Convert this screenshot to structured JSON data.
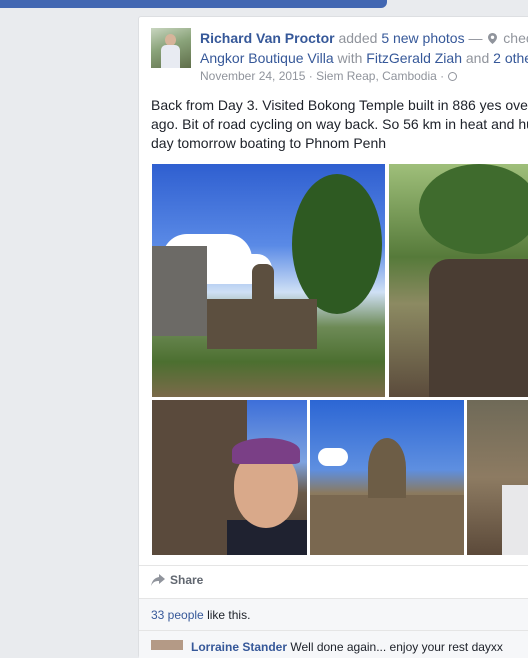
{
  "post": {
    "author": "Richard Van Proctor",
    "action": "added",
    "photo_count_label": "5 new photos",
    "dash": "—",
    "checkin_prefix": "chec",
    "place": "Angkor Boutique Villa",
    "with_word": "with",
    "tagged_person": "FitzGerald Ziah",
    "and_word": "and",
    "others": "2 othe",
    "date": "November 24, 2015",
    "location": "Siem Reap, Cambodia",
    "separator": "·",
    "text_lines": [
      "Back from Day 3. Visited Bokong Temple built in 886 yes ove",
      "ago. Bit of road cycling on way back. So 56 km in heat and hu",
      "day tomorrow boating to Phnom Penh"
    ],
    "share_label": "Share",
    "likes_count": "33 people",
    "likes_suffix": "like this."
  },
  "comment": {
    "author": "Lorraine Stander",
    "text": "Well done again... enjoy your rest dayxx"
  },
  "icons": {
    "location": "map-pin-icon",
    "privacy": "globe-icon",
    "share": "share-arrow-icon"
  },
  "colors": {
    "link": "#365899",
    "meta": "#90949c",
    "brand_bar": "#4267b2"
  }
}
